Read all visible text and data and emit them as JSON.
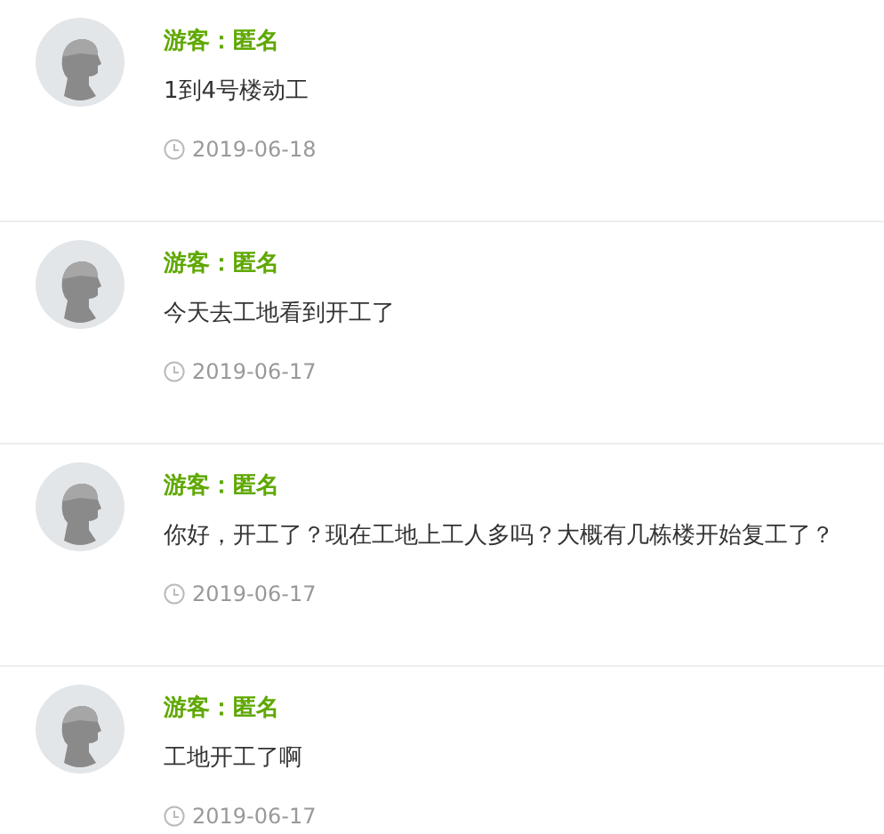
{
  "comments": [
    {
      "author": "游客：匿名",
      "text": "1到4号楼动工",
      "date": "2019-06-18"
    },
    {
      "author": "游客：匿名",
      "text": "今天去工地看到开工了",
      "date": "2019-06-17"
    },
    {
      "author": "游客：匿名",
      "text": "你好，开工了？现在工地上工人多吗？大概有几栋楼开始复工了？",
      "date": "2019-06-17"
    },
    {
      "author": "游客：匿名",
      "text": "工地开工了啊",
      "date": "2019-06-17"
    }
  ]
}
